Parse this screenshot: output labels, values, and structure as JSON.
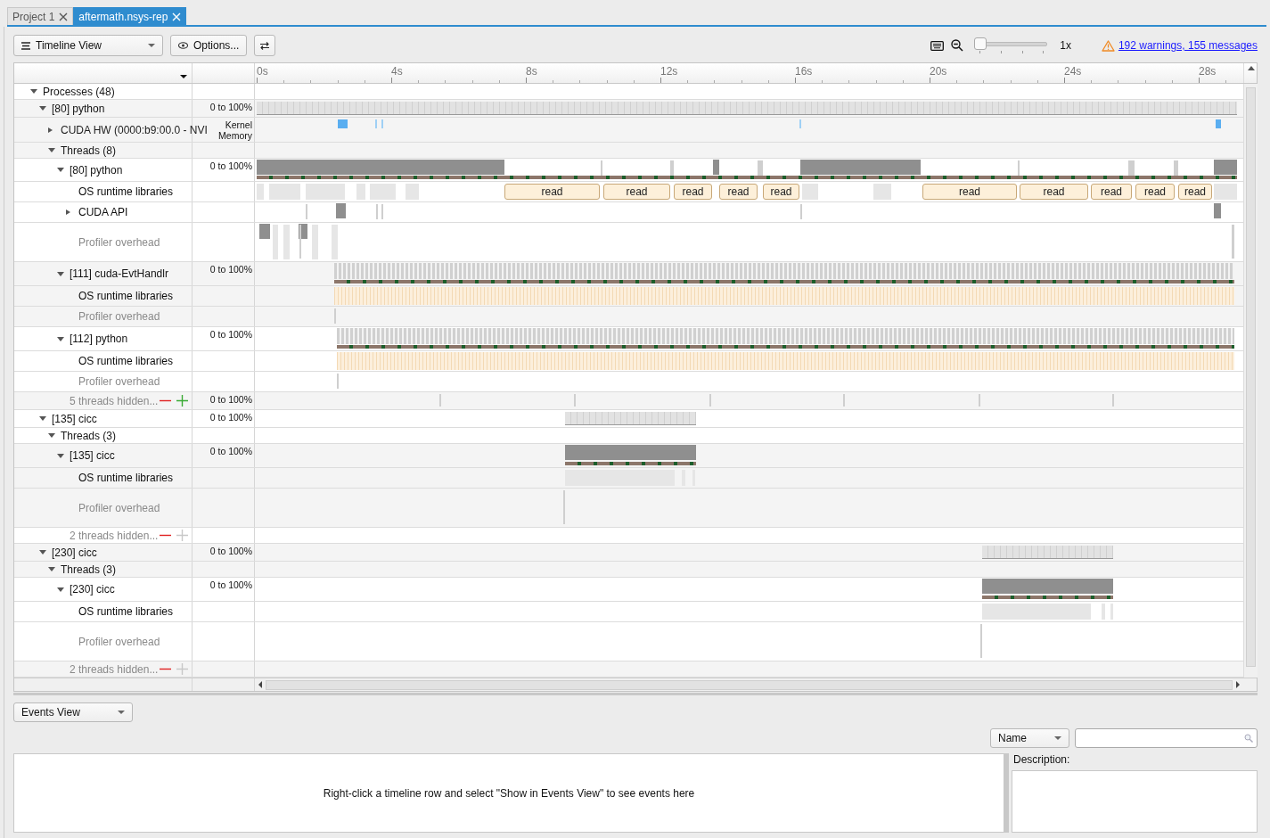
{
  "tabs": [
    {
      "label": "Project 1",
      "selected": false
    },
    {
      "label": "aftermath.nsys-rep",
      "selected": true
    }
  ],
  "toolbar": {
    "view": "Timeline View",
    "options": "Options...",
    "zoom": {
      "level": 0,
      "reading": "1x"
    },
    "warnings": "192 warnings, 155 messages"
  },
  "ruler": {
    "ticks": [
      "0s",
      "4s",
      "8s",
      "12s",
      "16s",
      "20s",
      "24s",
      "28s"
    ]
  },
  "tree": [
    {
      "kind": "group",
      "label": "Processes (48)",
      "expanded": true,
      "children": [
        {
          "kind": "process",
          "label": "[80] python",
          "expanded": true,
          "scale": [
            "0 to 100%"
          ],
          "children": [
            {
              "kind": "device",
              "label": "CUDA HW (0000:b9:00.0 - NVI",
              "expanded": false,
              "scale": [
                "Kernel",
                "Memory"
              ]
            },
            {
              "kind": "group",
              "label": "Threads (8)",
              "expanded": true,
              "children": [
                {
                  "kind": "thread",
                  "label": "[80] python",
                  "expanded": true,
                  "scale": [
                    "0 to 100%"
                  ],
                  "children": [
                    {
                      "kind": "os",
                      "label": "OS runtime libraries",
                      "events": [
                        "read",
                        "read",
                        "read",
                        "read",
                        "read",
                        "read",
                        "read",
                        "read",
                        "read",
                        "read"
                      ]
                    },
                    {
                      "kind": "api",
                      "label": "CUDA API",
                      "expanded": false
                    },
                    {
                      "kind": "overhead",
                      "label": "Profiler overhead"
                    }
                  ]
                },
                {
                  "kind": "thread",
                  "label": "[111] cuda-EvtHandlr",
                  "expanded": true,
                  "scale": [
                    "0 to 100%"
                  ],
                  "children": [
                    {
                      "kind": "os",
                      "label": "OS runtime libraries"
                    },
                    {
                      "kind": "overhead",
                      "label": "Profiler overhead"
                    }
                  ]
                },
                {
                  "kind": "thread",
                  "label": "[112] python",
                  "expanded": true,
                  "scale": [
                    "0 to 100%"
                  ],
                  "children": [
                    {
                      "kind": "os",
                      "label": "OS runtime libraries"
                    },
                    {
                      "kind": "overhead",
                      "label": "Profiler overhead"
                    }
                  ]
                },
                {
                  "kind": "hidden",
                  "label": "5 threads hidden...",
                  "can_show": true,
                  "scale": [
                    "0 to 100%"
                  ]
                }
              ]
            }
          ]
        },
        {
          "kind": "process",
          "label": "[135] cicc",
          "expanded": true,
          "scale": [
            "0 to 100%"
          ],
          "children": [
            {
              "kind": "group",
              "label": "Threads (3)",
              "expanded": true,
              "children": [
                {
                  "kind": "thread",
                  "label": "[135] cicc",
                  "expanded": true,
                  "scale": [
                    "0 to 100%"
                  ],
                  "children": [
                    {
                      "kind": "os",
                      "label": "OS runtime libraries"
                    },
                    {
                      "kind": "overhead",
                      "label": "Profiler overhead"
                    }
                  ]
                },
                {
                  "kind": "hidden",
                  "label": "2 threads hidden...",
                  "can_show": false
                }
              ]
            }
          ]
        },
        {
          "kind": "process",
          "label": "[230] cicc",
          "expanded": true,
          "scale": [
            "0 to 100%"
          ],
          "children": [
            {
              "kind": "group",
              "label": "Threads (3)",
              "expanded": true,
              "children": [
                {
                  "kind": "thread",
                  "label": "[230] cicc",
                  "expanded": true,
                  "scale": [
                    "0 to 100%"
                  ],
                  "children": [
                    {
                      "kind": "os",
                      "label": "OS runtime libraries"
                    },
                    {
                      "kind": "overhead",
                      "label": "Profiler overhead"
                    }
                  ]
                },
                {
                  "kind": "hidden",
                  "label": "2 threads hidden...",
                  "can_show": false
                }
              ]
            }
          ]
        }
      ]
    }
  ],
  "events_panel": {
    "view": "Events View",
    "filter": "Name",
    "message": "Right-click a timeline row and select \"Show in Events View\" to see events here",
    "description_label": "Description:"
  }
}
